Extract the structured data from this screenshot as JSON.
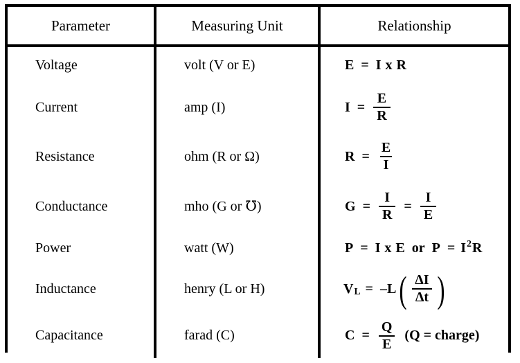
{
  "table": {
    "headers": {
      "parameter": "Parameter",
      "unit": "Measuring Unit",
      "relationship": "Relationship"
    },
    "rows": [
      {
        "parameter": "Voltage",
        "unit": "volt (V or E)",
        "relationship_text": "E = I x R",
        "relationship": {
          "lhs": "E",
          "eq": "=",
          "rhs_a": "I",
          "times": "x",
          "rhs_b": "R"
        }
      },
      {
        "parameter": "Current",
        "unit": "amp (I)",
        "relationship_text": "I = E/R",
        "relationship": {
          "lhs": "I",
          "eq": "=",
          "numerator": "E",
          "denominator": "R"
        }
      },
      {
        "parameter": "Resistance",
        "unit": "ohm (R or Ω)",
        "relationship_text": "R = E/I",
        "relationship": {
          "lhs": "R",
          "eq": "=",
          "numerator": "E",
          "denominator": "I"
        }
      },
      {
        "parameter": "Conductance",
        "unit": "mho (G or ℧)",
        "relationship_text": "G = I/R = I/E",
        "relationship": {
          "lhs": "G",
          "eq": "=",
          "numerator": "I",
          "denominator": "R",
          "eq2": "=",
          "numerator2": "I",
          "denominator2": "E"
        }
      },
      {
        "parameter": "Power",
        "unit": "watt (W)",
        "relationship_text": "P = I x E or P = I2R",
        "relationship": {
          "lhs": "P",
          "eq": "=",
          "rhs_a": "I",
          "times": "x",
          "rhs_b": "E",
          "conj": "or",
          "lhs2": "P",
          "eq2": "=",
          "base": "I",
          "exponent": "2",
          "tail": "R"
        }
      },
      {
        "parameter": "Inductance",
        "unit": "henry (L or H)",
        "relationship_text": "VL = -L (ΔI/Δt)",
        "relationship": {
          "lhs": "V",
          "lhs_sub": "L",
          "eq": "=",
          "coefficient": "–L",
          "paren_open": "(",
          "numerator": "ΔI",
          "denominator": "Δt",
          "paren_close": ")"
        }
      },
      {
        "parameter": "Capacitance",
        "unit": "farad (C)",
        "relationship_text": "C = Q/E (Q = charge)",
        "relationship": {
          "lhs": "C",
          "eq": "=",
          "numerator": "Q",
          "denominator": "E",
          "note": "(Q = charge)"
        }
      }
    ]
  },
  "colors": {
    "border": "#000000",
    "text": "#000000",
    "background": "#ffffff"
  }
}
